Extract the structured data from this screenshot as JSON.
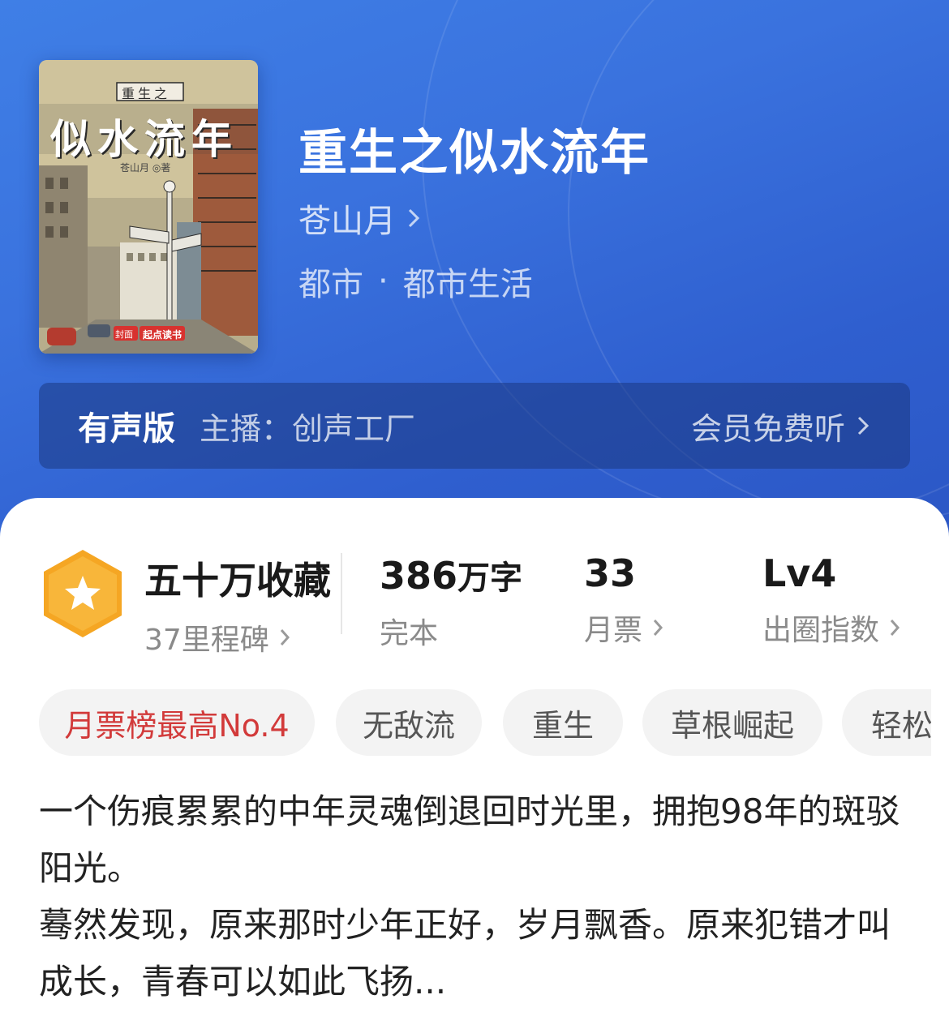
{
  "book": {
    "title": "重生之似水流年",
    "author": "苍山月",
    "genre": "都市",
    "genre_separator": "·",
    "subgenre": "都市生活",
    "cover": {
      "small_title": "重生之",
      "big_title": "似水流年",
      "author_line": "苍山月 ◎著",
      "publisher": "起点读书",
      "publisher_tag": "封面"
    }
  },
  "audio": {
    "tag": "有声版",
    "host": "主播：创声工厂",
    "action": "会员免费听"
  },
  "stats": {
    "collect": {
      "main": "五十万收藏",
      "sub": "37里程碑"
    },
    "words": {
      "number": "386",
      "unit": "万字",
      "sub": "完本"
    },
    "votes": {
      "main": "33",
      "sub": "月票"
    },
    "index": {
      "main": "Lv4",
      "sub": "出圈指数"
    }
  },
  "tags": [
    "月票榜最高No.4",
    "无敌流",
    "重生",
    "草根崛起",
    "轻松"
  ],
  "synopsis": {
    "line1": "一个伤痕累累的中年灵魂倒退回时光里，拥抱98年的斑驳阳光。",
    "line2": "蓦然发现，原来那时少年正好，岁月飘香。原来犯错才叫成长，青春可以如此飞扬..."
  },
  "colors": {
    "hero_blue": "#3a72de",
    "badge_orange": "#f5a623",
    "hot_tag_red": "#d23a3a"
  },
  "icons": [
    "chevron-right-icon",
    "star-badge-icon"
  ]
}
